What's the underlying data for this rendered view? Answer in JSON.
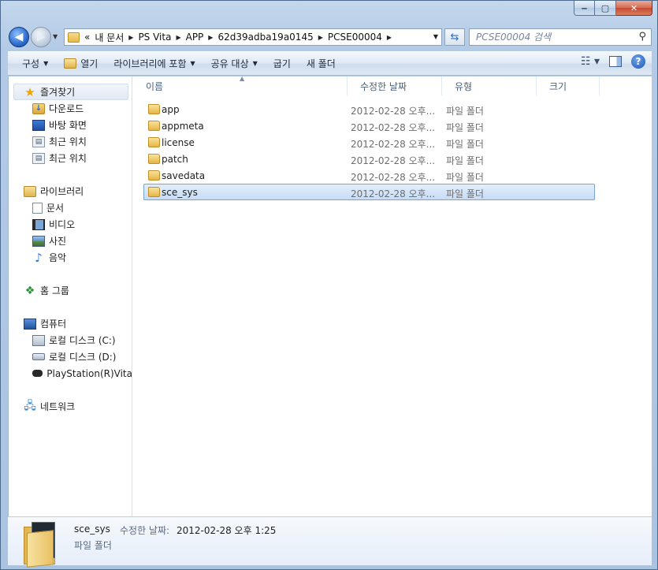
{
  "window": {
    "minimize_glyph": "‒",
    "maximize_glyph": "▢",
    "close_glyph": "✕"
  },
  "nav": {
    "back_glyph": "◀",
    "forward_glyph": "▶",
    "breadcrumbs": [
      "«",
      "내 문서",
      "PS Vita",
      "APP",
      "62d39adba19a0145",
      "PCSE00004"
    ],
    "search_placeholder": "PCSE00004 검색"
  },
  "toolbar": {
    "organize": "구성",
    "open": "열기",
    "include_in_library": "라이브러리에 포함",
    "share_with": "공유 대상",
    "burn": "굽기",
    "new_folder": "새 폴더"
  },
  "sidebar": {
    "favorites": "즐겨찾기",
    "downloads": "다운로드",
    "desktop": "바탕 화면",
    "recent1": "최근 위치",
    "recent2": "최근 위치",
    "libraries": "라이브러리",
    "documents": "문서",
    "videos": "비디오",
    "pictures": "사진",
    "music": "음악",
    "homegroup": "홈 그룹",
    "computer": "컴퓨터",
    "drive_c": "로컬 디스크 (C:)",
    "drive_d": "로컬 디스크 (D:)",
    "vita": "PlayStation(R)Vita",
    "network": "네트워크"
  },
  "columns": {
    "name": "이름",
    "modified": "수정한 날짜",
    "type": "유형",
    "size": "크기"
  },
  "files": [
    {
      "name": "app",
      "date": "2012-02-28 오후...",
      "type": "파일 폴더"
    },
    {
      "name": "appmeta",
      "date": "2012-02-28 오후...",
      "type": "파일 폴더"
    },
    {
      "name": "license",
      "date": "2012-02-28 오후...",
      "type": "파일 폴더"
    },
    {
      "name": "patch",
      "date": "2012-02-28 오후...",
      "type": "파일 폴더"
    },
    {
      "name": "savedata",
      "date": "2012-02-28 오후...",
      "type": "파일 폴더"
    },
    {
      "name": "sce_sys",
      "date": "2012-02-28 오후...",
      "type": "파일 폴더"
    }
  ],
  "details": {
    "name": "sce_sys",
    "modified_label": "수정한 날짜:",
    "modified_value": "2012-02-28 오후 1:25",
    "type": "파일 폴더"
  }
}
